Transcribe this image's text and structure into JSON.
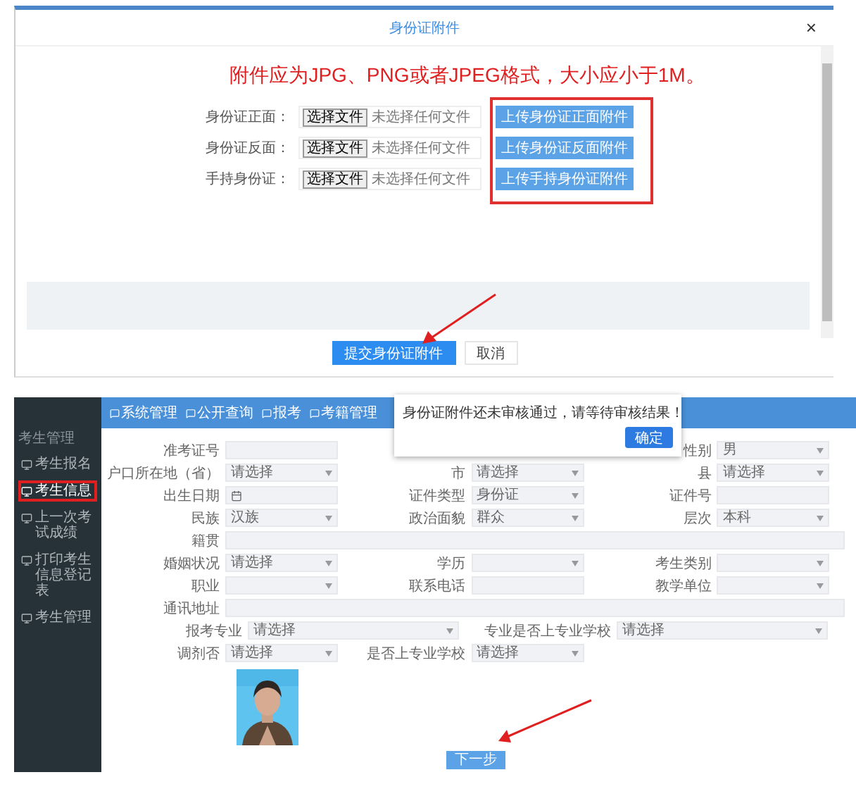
{
  "upload_dialog": {
    "title": "身份证附件",
    "close": "×",
    "notice": "附件应为JPG、PNG或者JPEG格式，大小应小于1M。",
    "rows": [
      {
        "label": "身份证正面：",
        "choose_button": "选择文件",
        "file_status": "未选择任何文件",
        "upload_button": "上传身份证正面附件"
      },
      {
        "label": "身份证反面：",
        "choose_button": "选择文件",
        "file_status": "未选择任何文件",
        "upload_button": "上传身份证反面附件"
      },
      {
        "label": "手持身份证：",
        "choose_button": "选择文件",
        "file_status": "未选择任何文件",
        "upload_button": "上传手持身份证附件"
      }
    ],
    "buttons": [
      {
        "label": "提交身份证附件",
        "kind": "primary"
      },
      {
        "label": "取消",
        "kind": "default"
      }
    ]
  },
  "registration_page": {
    "nav": [
      "系统管理",
      "公开查询",
      "报考",
      "考籍管理"
    ],
    "sidebar": {
      "heading": "考生管理",
      "items": [
        {
          "label": "考生报名",
          "selected": false
        },
        {
          "label": "考生信息",
          "selected": true
        },
        {
          "label": "上一次考试成绩",
          "selected": false
        },
        {
          "label": "打印考生信息登记表",
          "selected": false
        },
        {
          "label": "考生管理",
          "selected": false
        }
      ]
    },
    "alert": {
      "message": "身份证附件还未审核通过，请等待审核结果！",
      "button": "确定"
    },
    "form": {
      "rows": [
        {
          "fields": [
            {
              "label": "准考证号",
              "kind": "input"
            },
            {
              "kind": "gap"
            },
            {
              "label": "性别",
              "kind": "select",
              "value": "男"
            }
          ]
        },
        {
          "fields": [
            {
              "label": "户口所在地（省）",
              "kind": "select",
              "value": "请选择"
            },
            {
              "label": "市",
              "kind": "select",
              "value": "请选择"
            },
            {
              "label": "县",
              "kind": "select",
              "value": "请选择"
            }
          ]
        },
        {
          "fields": [
            {
              "label": "出生日期",
              "kind": "date"
            },
            {
              "label": "证件类型",
              "kind": "select",
              "value": "身份证"
            },
            {
              "label": "证件号",
              "kind": "input"
            }
          ]
        },
        {
          "fields": [
            {
              "label": "民族",
              "kind": "select",
              "value": "汉族"
            },
            {
              "label": "政治面貌",
              "kind": "select",
              "value": "群众"
            },
            {
              "label": "层次",
              "kind": "select",
              "value": "本科"
            }
          ]
        },
        {
          "fields": [
            {
              "label": "籍贯",
              "kind": "input"
            }
          ]
        },
        {
          "fields": [
            {
              "label": "婚姻状况",
              "kind": "select",
              "value": "请选择"
            },
            {
              "label": "学历",
              "kind": "select"
            },
            {
              "label": "考生类别",
              "kind": "select"
            }
          ]
        },
        {
          "fields": [
            {
              "label": "职业",
              "kind": "select"
            },
            {
              "label": "联系电话",
              "kind": "input"
            },
            {
              "label": "教学单位",
              "kind": "select"
            }
          ]
        },
        {
          "fields": [
            {
              "label": "通讯地址",
              "kind": "input"
            }
          ]
        },
        {
          "fields": [
            {
              "label": "报考专业",
              "kind": "select",
              "value": "请选择",
              "wide": true
            },
            {
              "label": "专业是否上专业学校",
              "kind": "select",
              "value": "请选择",
              "wide": true
            }
          ]
        },
        {
          "fields": [
            {
              "label": "调剂否",
              "kind": "select",
              "value": "请选择"
            },
            {
              "label": "是否上专业学校",
              "kind": "select",
              "value": "请选择"
            }
          ]
        }
      ]
    },
    "photo": {
      "kind": "picture"
    },
    "next_button": "下一步"
  }
}
